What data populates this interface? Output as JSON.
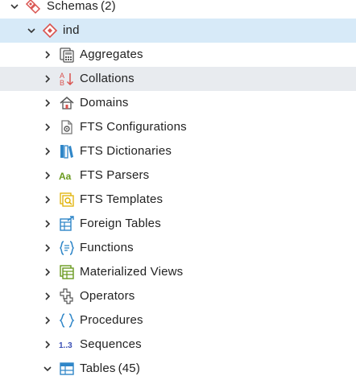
{
  "tree": {
    "schemas": {
      "label": "Schemas",
      "count": "(2)",
      "icon": "schemas-icon"
    },
    "schema": {
      "label": "ind",
      "icon": "schema-icon"
    },
    "items": [
      {
        "label": "Aggregates",
        "icon": "aggregates-icon"
      },
      {
        "label": "Collations",
        "icon": "collations-icon"
      },
      {
        "label": "Domains",
        "icon": "domains-icon"
      },
      {
        "label": "FTS Configurations",
        "icon": "fts-configurations-icon"
      },
      {
        "label": "FTS Dictionaries",
        "icon": "fts-dictionaries-icon"
      },
      {
        "label": "FTS Parsers",
        "icon": "fts-parsers-icon",
        "icon_text": "Aa"
      },
      {
        "label": "FTS Templates",
        "icon": "fts-templates-icon"
      },
      {
        "label": "Foreign Tables",
        "icon": "foreign-tables-icon"
      },
      {
        "label": "Functions",
        "icon": "functions-icon"
      },
      {
        "label": "Materialized Views",
        "icon": "materialized-views-icon"
      },
      {
        "label": "Operators",
        "icon": "operators-icon"
      },
      {
        "label": "Procedures",
        "icon": "procedures-icon"
      },
      {
        "label": "Sequences",
        "icon": "sequences-icon",
        "icon_text": "1..3"
      },
      {
        "label": "Tables",
        "count": "(45)",
        "icon": "tables-icon"
      }
    ]
  },
  "colors": {
    "selected_row": "#d7eaf8",
    "hover_row": "#e8ebef",
    "schema_red": "#d9534f",
    "icon_blue": "#2f86c8",
    "icon_green": "#6a9a1f",
    "icon_yellow": "#e0b000"
  }
}
